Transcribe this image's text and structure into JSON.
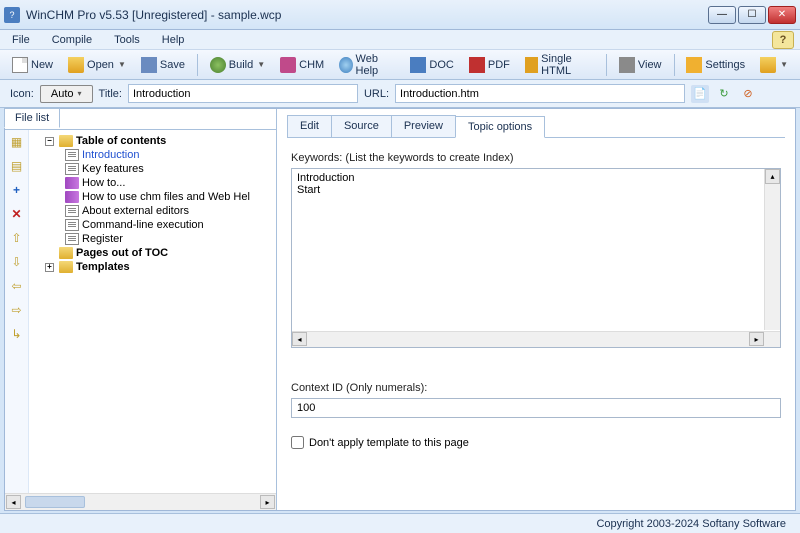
{
  "window": {
    "title": "WinCHM Pro v5.53 [Unregistered] - sample.wcp"
  },
  "menu": {
    "file": "File",
    "compile": "Compile",
    "tools": "Tools",
    "help": "Help"
  },
  "toolbar": {
    "new": "New",
    "open": "Open",
    "save": "Save",
    "build": "Build",
    "chm": "CHM",
    "webhelp": "Web Help",
    "doc": "DOC",
    "pdf": "PDF",
    "singlehtml": "Single HTML",
    "view": "View",
    "settings": "Settings"
  },
  "propbar": {
    "icon_label": "Icon:",
    "auto": "Auto",
    "title_label": "Title:",
    "title_value": "Introduction",
    "url_label": "URL:",
    "url_value": "Introduction.htm"
  },
  "filelist": {
    "tab": "File list",
    "nodes": {
      "toc": "Table of contents",
      "intro": "Introduction",
      "keyfeatures": "Key features",
      "howto": "How to...",
      "howtochm": "How to use chm files and Web Hel",
      "abouteditors": "About external editors",
      "cmdline": "Command-line execution",
      "register": "Register",
      "pagesout": "Pages out of TOC",
      "templates": "Templates"
    }
  },
  "tabs": {
    "edit": "Edit",
    "source": "Source",
    "preview": "Preview",
    "topic": "Topic options"
  },
  "topic": {
    "keywords_label": "Keywords: (List the keywords to create Index)",
    "keywords_value": "Introduction\nStart",
    "context_label": "Context ID (Only numerals):",
    "context_value": "100",
    "dont_apply": "Don't apply template to this page"
  },
  "status": {
    "copyright": "Copyright 2003-2024 Softany Software"
  }
}
